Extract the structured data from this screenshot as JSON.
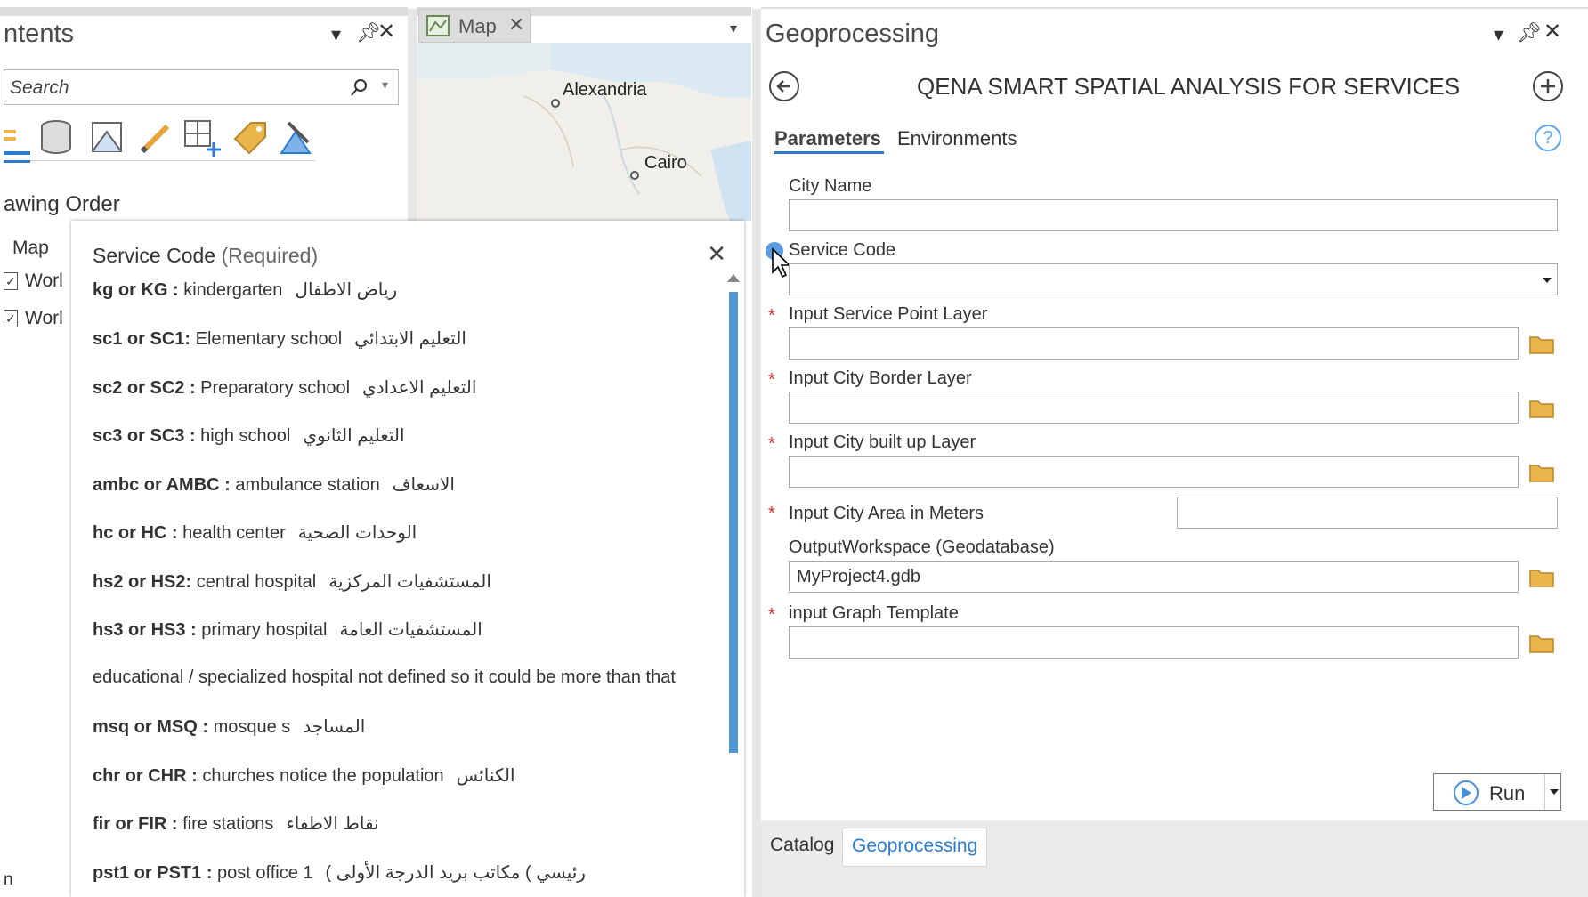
{
  "contents": {
    "title": "ntents",
    "search_placeholder": "Search",
    "section": "awing Order",
    "tree_map": "Map",
    "layers": [
      "Worl",
      "Worl"
    ],
    "status": "n"
  },
  "map": {
    "tab_label": "Map",
    "cities": [
      "Alexandria",
      "Cairo"
    ]
  },
  "popup": {
    "title": "Service Code",
    "title_suffix": "(Required)",
    "rows": [
      {
        "code": "kg or KG :",
        "desc": "kindergarten",
        "ar": "رياض الاطفال"
      },
      {
        "code": "sc1 or SC1:",
        "desc": "Elementary school",
        "ar": "التعليم الابتدائي"
      },
      {
        "code": "sc2 or SC2 :",
        "desc": "Preparatory school",
        "ar": "التعليم الاعدادي"
      },
      {
        "code": "sc3 or SC3 :",
        "desc": "high school",
        "ar": "التعليم الثانوي"
      },
      {
        "code": "ambc or AMBC :",
        "desc": "ambulance station",
        "ar": "الاسعاف"
      },
      {
        "code": "hc or HC :",
        "desc": "health center",
        "ar": "الوحدات الصحية"
      },
      {
        "code": "hs2 or HS2:",
        "desc": "central hospital",
        "ar": "المستشفيات المركزية"
      },
      {
        "code": "hs3 or HS3 :",
        "desc": "primary hospital",
        "ar": "المستشفيات العامة"
      },
      {
        "code": "",
        "desc": "educational / specialized hospital not defined so it could be more than that",
        "ar": ""
      },
      {
        "code": "msq or MSQ :",
        "desc": "mosque s",
        "ar": "المساجد"
      },
      {
        "code": "chr or CHR :",
        "desc": "churches notice the population",
        "ar": "الكنائس"
      },
      {
        "code": "fir or FIR :",
        "desc": "fire stations",
        "ar": "نقاط الاطفاء"
      },
      {
        "code": "pst1 or PST1 :",
        "desc": "post office 1",
        "ar": "رئيسي )   مكاتب بريد الدرجة الأولى )"
      }
    ]
  },
  "geo": {
    "pane_title": "Geoprocessing",
    "tool_title": "QENA SMART SPATIAL ANALYSIS FOR SERVICES",
    "tabs": [
      "Parameters",
      "Environments"
    ],
    "params": {
      "city_name": "City Name",
      "service_code": "Service Code",
      "service_point": "Input Service Point Layer",
      "city_border": "Input City Border Layer",
      "built_up": "Input City built up Layer",
      "area": "Input City Area in Meters",
      "workspace": "OutputWorkspace (Geodatabase)",
      "workspace_value": "MyProject4.gdb",
      "graph": "input Graph Template"
    },
    "run_label": "Run",
    "bottom_tabs": [
      "Catalog",
      "Geoprocessing"
    ],
    "required_star": "*",
    "help": "?"
  },
  "colors": {
    "accent": "#2b7bd0",
    "required": "#d12c2c",
    "folder": "#e8b64a",
    "scroll": "#4f95d8"
  }
}
